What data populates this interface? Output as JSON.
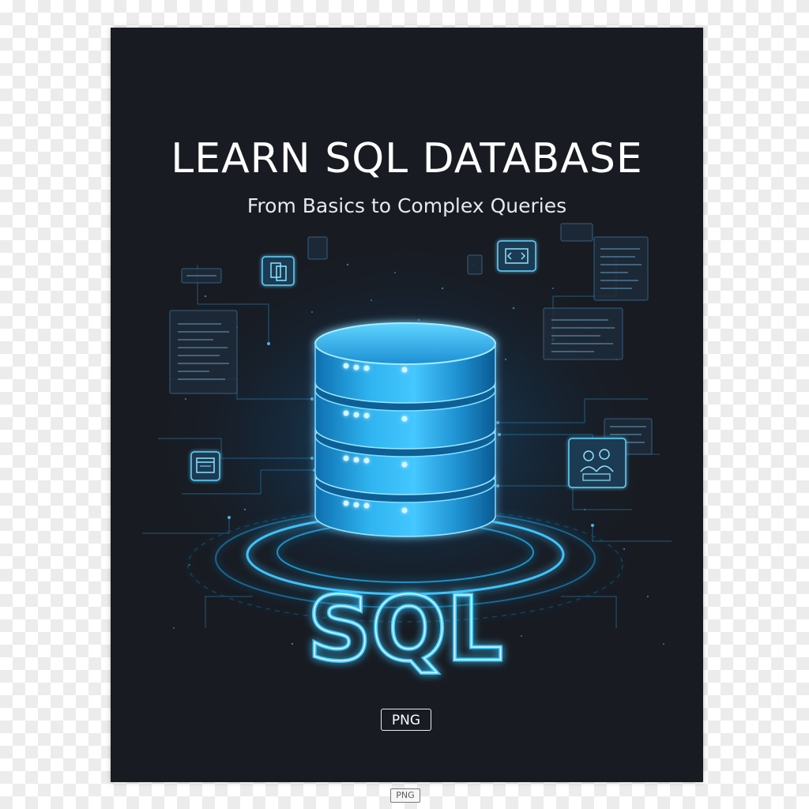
{
  "poster": {
    "title": "LEARN SQL DATABASE",
    "subtitle": "From Basics to Complex Queries",
    "logo_text": "SQL",
    "badge": "PNG"
  },
  "footer": {
    "badge": "PNG"
  },
  "colors": {
    "background": "#181b22",
    "accent": "#2fc8ff",
    "glow": "#5fe4ff",
    "text": "#ffffff"
  },
  "icons": [
    "database-icon",
    "document-icon",
    "chat-icon",
    "code-icon",
    "users-icon",
    "browser-icon"
  ]
}
